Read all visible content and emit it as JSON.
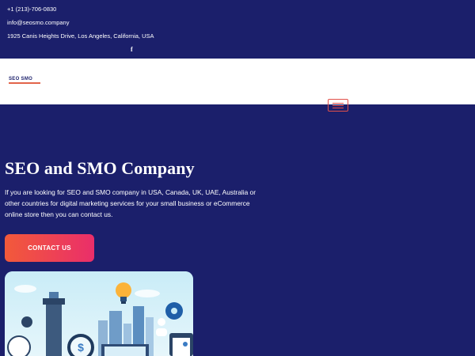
{
  "topbar": {
    "phone": "+1 (213)-706-0830",
    "email": "info@seosmo.company",
    "address": "1925 Canis Heights Drive, Los Angeles, California, USA",
    "facebook_glyph": "f"
  },
  "header": {
    "logo_text": "SEO SMO",
    "menu_icon": "hamburger-menu-icon"
  },
  "hero": {
    "title": "SEO and SMO Company",
    "description": "If you are looking for SEO and SMO company in USA, Canada, UK, UAE, Australia or other countries for digital marketing services for your small business or eCommerce online store then you can contact us.",
    "cta_label": "CONTACT US"
  },
  "colors": {
    "background": "#1b1f6b",
    "accent_start": "#f25a3a",
    "accent_end": "#ea2e6a",
    "navbar": "#ffffff"
  }
}
